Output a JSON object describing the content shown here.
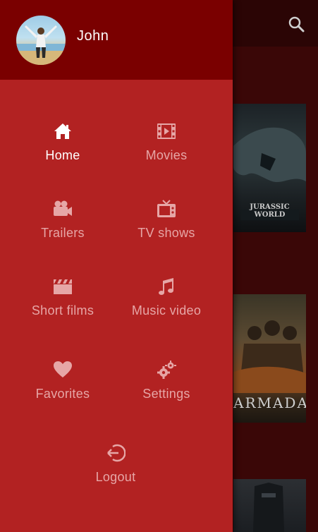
{
  "user": {
    "name": "John"
  },
  "menu": {
    "home": "Home",
    "movies": "Movies",
    "trailers": "Trailers",
    "tv_shows": "TV shows",
    "short_films": "Short films",
    "music_video": "Music video",
    "favorites": "Favorites",
    "settings": "Settings",
    "logout": "Logout",
    "active_item": "Home"
  },
  "background": {
    "posters": [
      {
        "caption": "JURASSIC WORLD"
      },
      {
        "caption": "ARMADA"
      },
      {
        "caption": ""
      }
    ]
  },
  "colors": {
    "drawer": "#b22222",
    "drawer_header": "#7a0000",
    "icon_active": "#ffffff",
    "icon_inactive": "#e6a6a6"
  },
  "icons": [
    "home-icon",
    "film-icon",
    "video-camera-icon",
    "tv-icon",
    "clapperboard-icon",
    "music-note-icon",
    "heart-icon",
    "cogs-icon",
    "logout-icon",
    "search-icon"
  ]
}
